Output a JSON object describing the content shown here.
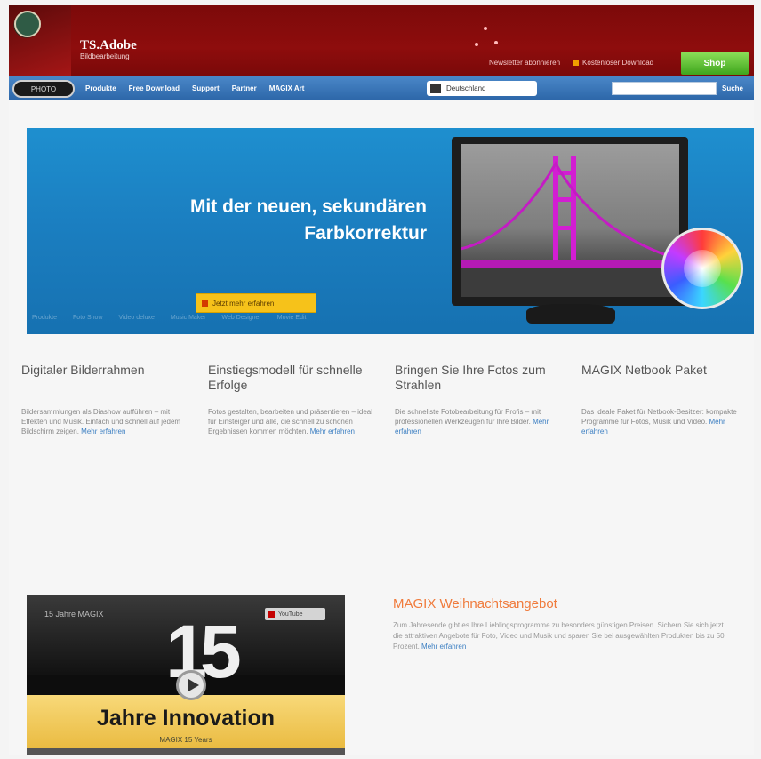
{
  "header": {
    "brand_line1": "TS.Adobe",
    "brand_line2": "Bildbearbeitung",
    "link_newsletter": "Newsletter abonnieren",
    "link_download": "Kostenloser Download",
    "shop_button": "Shop"
  },
  "nav": {
    "logo_label": "PHOTO",
    "items": [
      "Produkte",
      "Free Download",
      "Support",
      "Partner",
      "MAGIX Art"
    ],
    "language": "Deutschland",
    "search_placeholder": "",
    "search_button": "Suche"
  },
  "hero": {
    "title": "Mit der neuen, sekundären\nFarbkorrektur",
    "cta": "Jetzt mehr erfahren",
    "strip": [
      "Produkte",
      "Foto Show",
      "Video deluxe",
      "Music Maker",
      "Web Designer",
      "Movie Edit"
    ]
  },
  "features": [
    {
      "title": "Digitaler Bilderrahmen",
      "text": "Bildersammlungen als Diashow aufführen – mit Effekten und Musik. Einfach und schnell auf jedem Bildschirm zeigen.",
      "more": "Mehr erfahren"
    },
    {
      "title": "Einstiegsmodell für schnelle Erfolge",
      "text": "Fotos gestalten, bearbeiten und präsentieren – ideal für Einsteiger und alle, die schnell zu schönen Ergebnissen kommen möchten.",
      "more": "Mehr erfahren"
    },
    {
      "title": "Bringen Sie Ihre Fotos zum Strahlen",
      "text": "Die schnellste Fotobearbeitung für Profis – mit professionellen Werkzeugen für Ihre Bilder.",
      "more": "Mehr erfahren"
    },
    {
      "title": "MAGIX Netbook Paket",
      "text": "Das ideale Paket für Netbook-Besitzer: kompakte Programme für Fotos, Musik und Video.",
      "more": "Mehr erfahren"
    }
  ],
  "video": {
    "label": "15 Jahre MAGIX",
    "badge": "YouTube",
    "number": "15",
    "headline": "Jahre Innovation",
    "sub": "MAGIX 15 Years"
  },
  "promo": {
    "title": "MAGIX Weihnachtsangebot",
    "text": "Zum Jahresende gibt es Ihre Lieblingsprogramme zu besonders günstigen Preisen. Sichern Sie sich jetzt die attraktiven Angebote für Foto, Video und Musik und sparen Sie bei ausgewählten Produkten bis zu 50 Prozent.",
    "more": "Mehr erfahren"
  }
}
